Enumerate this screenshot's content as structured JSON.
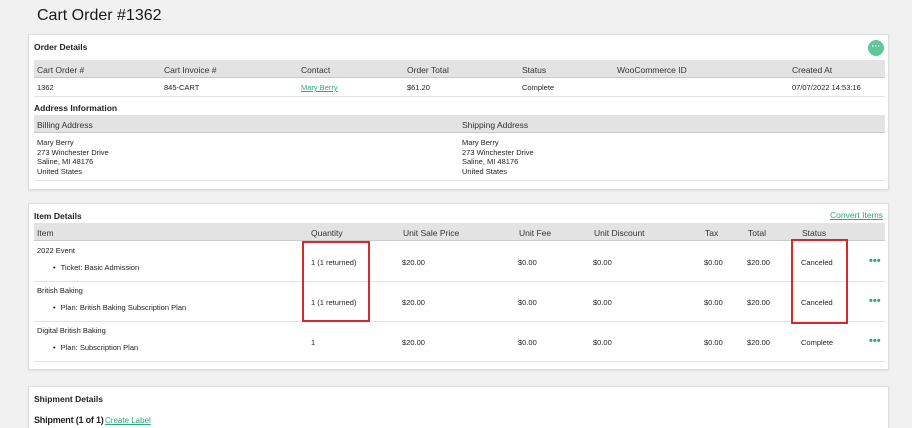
{
  "page": {
    "title": "Cart Order #1362"
  },
  "order_details": {
    "title": "Order Details",
    "headers": [
      "Cart Order #",
      "Cart Invoice #",
      "Contact",
      "Order Total",
      "Status",
      "WooCommerce ID",
      "Created At"
    ],
    "row": {
      "order_number": "1362",
      "invoice": "845-CART",
      "contact": "Mary Berry",
      "total": "$61.20",
      "status": "Complete",
      "woocommerce_id": "",
      "created_at": "07/07/2022 14:53:16"
    },
    "more_icon": "ellipsis-icon",
    "accent_color": "#61c79a"
  },
  "address": {
    "title": "Address Information",
    "billing_header": "Billing Address",
    "shipping_header": "Shipping Address",
    "billing": [
      "Mary Berry",
      "273 Winchester Drive",
      "Saline, MI 48176",
      "United States"
    ],
    "shipping": [
      "Mary Berry",
      "273 Winchester Drive",
      "Saline, MI 48176",
      "United States"
    ]
  },
  "item_details": {
    "title": "Item Details",
    "convert_link": "Convert Items",
    "headers": [
      "Item",
      "Quantity",
      "Unit Sale Price",
      "Unit Fee",
      "Unit Discount",
      "Tax",
      "Total",
      "Status"
    ],
    "rows": [
      {
        "name": "2022 Event",
        "sub": "Ticket: Basic Admission",
        "quantity": "1 (1 returned)",
        "unit_price": "$20.00",
        "unit_fee": "$0.00",
        "unit_discount": "$0.00",
        "tax": "$0.00",
        "total": "$20.00",
        "status": "Canceled",
        "actions": "•••"
      },
      {
        "name": "British Baking",
        "sub": "Plan: British Baking Subscription Plan",
        "quantity": "1 (1 returned)",
        "unit_price": "$20.00",
        "unit_fee": "$0.00",
        "unit_discount": "$0.00",
        "tax": "$0.00",
        "total": "$20.00",
        "status": "Canceled",
        "actions": "•••"
      },
      {
        "name": "Digital British Baking",
        "sub": "Plan: Subscription Plan",
        "quantity": "1",
        "unit_price": "$20.00",
        "unit_fee": "$0.00",
        "unit_discount": "$0.00",
        "tax": "$0.00",
        "total": "$20.00",
        "status": "Complete",
        "actions": "•••"
      }
    ],
    "highlight_color": "#d42a2a"
  },
  "shipment": {
    "title": "Shipment Details",
    "subtitle": "Shipment (1 of 1)",
    "create_label": "Create Label"
  }
}
